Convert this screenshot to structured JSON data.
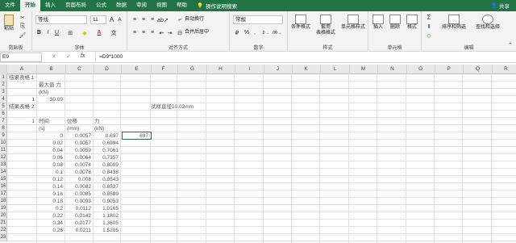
{
  "menubar": {
    "tabs": [
      "文件",
      "开始",
      "插入",
      "页面布局",
      "公式",
      "数据",
      "审阅",
      "视图",
      "帮助"
    ],
    "search": "操作说明搜索",
    "share": "共享"
  },
  "ribbon": {
    "clipboard": {
      "paste": "粘贴",
      "label": "剪贴板"
    },
    "font": {
      "name": "等线",
      "size": "11",
      "label": "字体",
      "bold": "B",
      "italic": "I",
      "underline": "U",
      "grow": "A",
      "shrink": "A",
      "color": "A"
    },
    "align": {
      "wrap": "自动换行",
      "merge": "合并后居中",
      "label": "对齐方式"
    },
    "number": {
      "format": "常规",
      "label": "数字",
      "percent": "%",
      "comma": ",",
      "currency": "₽"
    },
    "styles": {
      "cond": "条件格式",
      "table": "套用\n表格格式",
      "cell": "单元格样式",
      "label": "样式"
    },
    "cells": {
      "insert": "插入",
      "delete": "删除",
      "format": "格式",
      "label": "单元格"
    },
    "edit": {
      "sort": "排序和筛选",
      "find": "查找和选择",
      "label": "编辑",
      "sum": "Σ"
    }
  },
  "formula_bar": {
    "name_box": "E9",
    "cancel": "✕",
    "enter": "✓",
    "fx": "fx",
    "formula": "=D9*1000"
  },
  "columns": [
    "A",
    "B",
    "C",
    "D",
    "E",
    "F",
    "G",
    "H",
    "I",
    "J",
    "K",
    "L",
    "M",
    "N",
    "O",
    "P",
    "Q",
    "R"
  ],
  "rows": [
    "1",
    "2",
    "3",
    "4",
    "5",
    "6",
    "7",
    "8",
    "9",
    "10",
    "11",
    "12",
    "13",
    "14",
    "15",
    "16",
    "17",
    "18",
    "19",
    "20",
    "21",
    "22",
    "23"
  ],
  "cells": {
    "A1": "结果表格 1",
    "B2": "最大值 力",
    "B3": "(kN)",
    "A4": "1",
    "B4": "30.09",
    "A5": "结果表格 2",
    "F5": "试样直径10.02mm",
    "A7": "1",
    "B7": "时间",
    "C7": "位移",
    "D7": "力",
    "B8": "(s)",
    "C8": "(mm)",
    "D8": "(kN)",
    "E9": "697"
  },
  "table": [
    [
      "0",
      "0.0057",
      "0.697"
    ],
    [
      "0.02",
      "0.0057",
      "0.6994"
    ],
    [
      "0.04",
      "0.0059",
      "0.7061"
    ],
    [
      "0.06",
      "0.0064",
      "0.7357"
    ],
    [
      "0.08",
      "0.0074",
      "0.8009"
    ],
    [
      "0.1",
      "0.0078",
      "0.8438"
    ],
    [
      "0.12",
      "0.008",
      "0.8543"
    ],
    [
      "0.14",
      "0.0082",
      "0.8527"
    ],
    [
      "0.16",
      "0.0085",
      "0.8589"
    ],
    [
      "0.18",
      "0.0093",
      "0.9053"
    ],
    [
      "0.2",
      "0.0112",
      "1.0165"
    ],
    [
      "0.22",
      "0.0142",
      "1.1802"
    ],
    [
      "0.24",
      "0.0177",
      "1.3605"
    ],
    [
      "0.26",
      "0.0211",
      "1.5205"
    ]
  ]
}
